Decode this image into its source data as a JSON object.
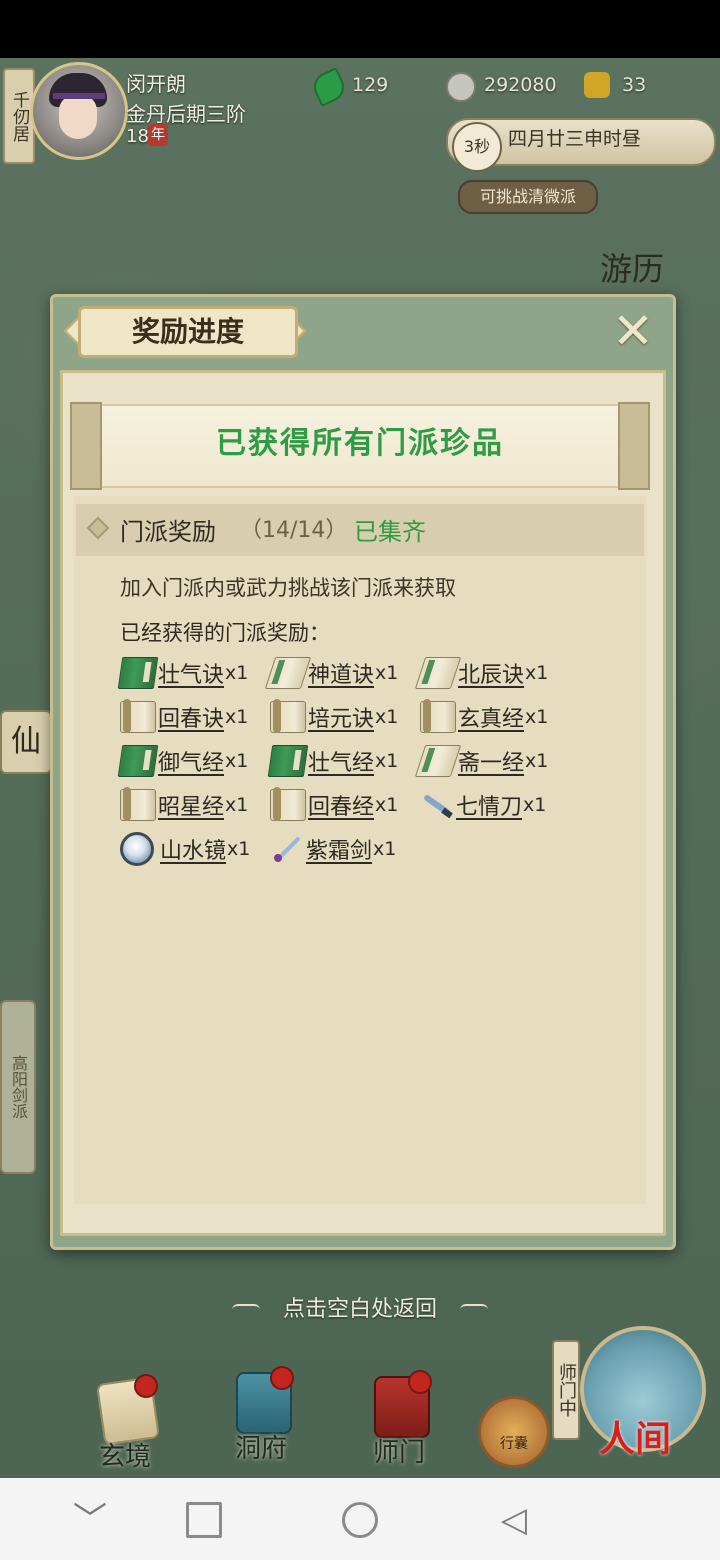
{
  "hud": {
    "location_tag": "千仞居",
    "player_name": "闵开朗",
    "realm": "金丹后期三阶",
    "age": "18",
    "age_unit": "年",
    "jade": "129",
    "coins": "292080",
    "strength": "33",
    "timer": "3秒",
    "date": "四月廿三申时昼",
    "challenge": "可挑战清微派",
    "youli": "游历",
    "left_sign": "仙",
    "side_tab": "高阳剑派"
  },
  "dialog": {
    "title": "奖励进度",
    "close": "✕",
    "banner": "已获得所有门派珍品",
    "reward_title": "门派奖励",
    "reward_count": "（14/14）",
    "reward_status": "已集齐",
    "description": "加入门派内或武力挑战该门派来获取",
    "obtained_label": "已经获得的门派奖励：",
    "items": [
      {
        "name": "壮气诀",
        "qty": "x1",
        "icon": "green-book-icon"
      },
      {
        "name": "神道诀",
        "qty": "x1",
        "icon": "open-book-icon"
      },
      {
        "name": "北辰诀",
        "qty": "x1",
        "icon": "open-book-icon"
      },
      {
        "name": "回春诀",
        "qty": "x1",
        "icon": "scroll-icon"
      },
      {
        "name": "培元诀",
        "qty": "x1",
        "icon": "scroll-icon"
      },
      {
        "name": "玄真经",
        "qty": "x1",
        "icon": "scroll-icon"
      },
      {
        "name": "御气经",
        "qty": "x1",
        "icon": "green-book-icon"
      },
      {
        "name": "壮气经",
        "qty": "x1",
        "icon": "green-book-icon"
      },
      {
        "name": "斋一经",
        "qty": "x1",
        "icon": "open-book-icon"
      },
      {
        "name": "昭星经",
        "qty": "x1",
        "icon": "scroll-icon"
      },
      {
        "name": "回春经",
        "qty": "x1",
        "icon": "scroll-icon"
      },
      {
        "name": "七情刀",
        "qty": "x1",
        "icon": "blade-icon"
      },
      {
        "name": "山水镜",
        "qty": "x1",
        "icon": "mirror-icon"
      },
      {
        "name": "紫霜剑",
        "qty": "x1",
        "icon": "sword-icon"
      }
    ],
    "tap_return": "点击空白处返回"
  },
  "bottom_nav": {
    "xuanjing": "玄境",
    "dongfu": "洞府",
    "shimen": "师门",
    "bag": "行囊",
    "renjian": "人间",
    "shimen_zhong": "师门中"
  },
  "system_nav": {
    "down": "﹀",
    "back": "◁"
  }
}
